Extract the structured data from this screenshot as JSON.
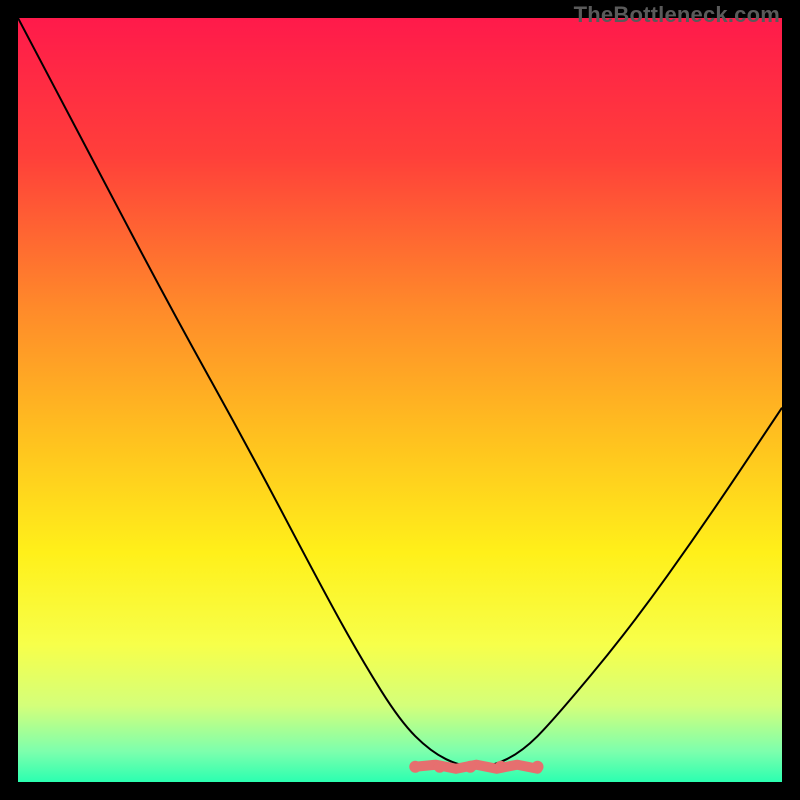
{
  "watermark": {
    "text": "TheBottleneck.com"
  },
  "chart_data": {
    "type": "line",
    "title": "",
    "xlabel": "",
    "ylabel": "",
    "xlim": [
      0,
      100
    ],
    "ylim": [
      0,
      100
    ],
    "grid": false,
    "legend": false,
    "series": [
      {
        "name": "bottleneck-curve",
        "x": [
          0,
          10,
          20,
          30,
          40,
          45,
          50,
          54,
          58,
          62,
          66,
          70,
          80,
          90,
          100
        ],
        "y": [
          100,
          81,
          62,
          44,
          25,
          16,
          8,
          4,
          2,
          2,
          4,
          8,
          20,
          34,
          49
        ]
      }
    ],
    "highlight_region": {
      "name": "optimal-flat-region",
      "x_range": [
        52,
        68
      ],
      "y": 2
    },
    "gradient_stops": [
      {
        "offset": 0.0,
        "color": "#ff1a4b"
      },
      {
        "offset": 0.18,
        "color": "#ff3f3a"
      },
      {
        "offset": 0.38,
        "color": "#ff8a2a"
      },
      {
        "offset": 0.55,
        "color": "#ffc11f"
      },
      {
        "offset": 0.7,
        "color": "#fff01a"
      },
      {
        "offset": 0.82,
        "color": "#f7ff4a"
      },
      {
        "offset": 0.9,
        "color": "#d4ff7a"
      },
      {
        "offset": 0.96,
        "color": "#7dffad"
      },
      {
        "offset": 1.0,
        "color": "#2bffb0"
      }
    ]
  }
}
